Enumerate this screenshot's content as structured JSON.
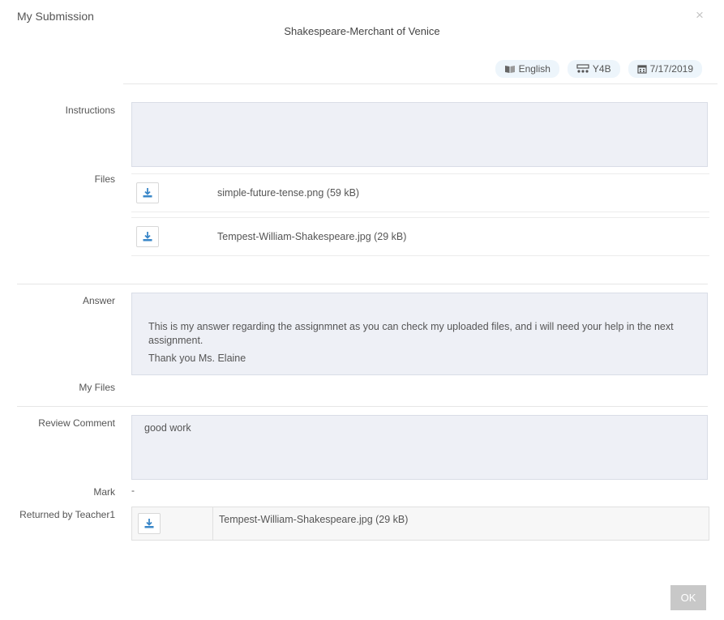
{
  "dialog": {
    "title": "My Submission",
    "close_glyph": "×",
    "assignment_title": "Shakespeare-Merchant of Venice"
  },
  "tags": [
    {
      "icon": "book-icon",
      "label": "English"
    },
    {
      "icon": "class-group-icon",
      "label": "Y4B"
    },
    {
      "icon": "calendar-icon",
      "label": "7/17/2019"
    }
  ],
  "labels": {
    "instructions": "Instructions",
    "files": "Files",
    "answer": "Answer",
    "my_files": "My Files",
    "review_comment": "Review Comment",
    "mark": "Mark",
    "returned_by": "Returned by Teacher1"
  },
  "instructions": "",
  "files": [
    {
      "name": "simple-future-tense.png (59 kB)"
    },
    {
      "name": "Tempest-William-Shakespeare.jpg (29 kB)"
    }
  ],
  "answer": {
    "line1": "This is my answer regarding the assignmnet as you can check my uploaded files, and i will need your help in the next assignment.",
    "line2": "Thank you Ms. Elaine"
  },
  "review_comment": "good work",
  "mark": "-",
  "returned_files": [
    {
      "name": "Tempest-William-Shakespeare.jpg (29 kB)"
    }
  ],
  "buttons": {
    "ok": "OK"
  },
  "colors": {
    "accent": "#3a87c8",
    "tag_bg": "#edf5fb",
    "box_bg": "#eef0f6",
    "ok_bg": "#c8c8c8"
  }
}
